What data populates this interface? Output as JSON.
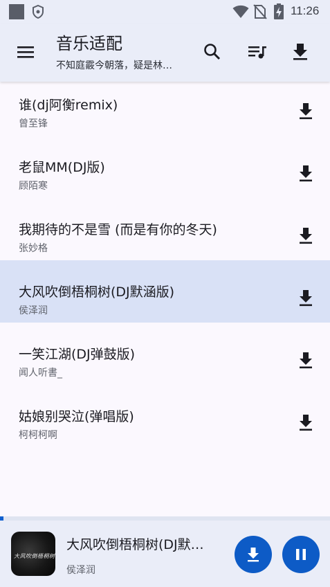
{
  "status_bar": {
    "time": "11:26",
    "icons": [
      "notification-square-icon",
      "shield-icon",
      "wifi-icon",
      "no-sim-icon",
      "battery-charging-icon"
    ]
  },
  "app_bar": {
    "title": "音乐适配",
    "subtitle": "不知庭霰今朝落，疑是林…",
    "icons": [
      "menu-icon",
      "search-icon",
      "playlist-icon",
      "download-icon"
    ]
  },
  "songs": [
    {
      "title": "谁(dj阿衡remix)",
      "artist": "曾至锋",
      "active": false
    },
    {
      "title": "老鼠MM(DJ版)",
      "artist": "顾陌寒",
      "active": false
    },
    {
      "title": "我期待的不是雪 (而是有你的冬天)",
      "artist": "张妙格",
      "active": false
    },
    {
      "title": "大风吹倒梧桐树(DJ默涵版)",
      "artist": "侯泽润",
      "active": true
    },
    {
      "title": "一笑江湖(DJ弹鼓版)",
      "artist": "闻人听書_",
      "active": false
    },
    {
      "title": "姑娘别哭泣(弹唱版)",
      "artist": "柯柯柯啊",
      "active": false
    }
  ],
  "player": {
    "title": "大风吹倒梧桐树(DJ默…",
    "artist": "侯泽润",
    "cover_text": "大风吹倒梧桐树",
    "progress_fraction": 0.01
  },
  "colors": {
    "accent": "#0d5bc6",
    "app_bar_bg": "#eaedf8",
    "active_row_bg": "#d9e1f6",
    "page_bg": "#fbf8fe"
  }
}
